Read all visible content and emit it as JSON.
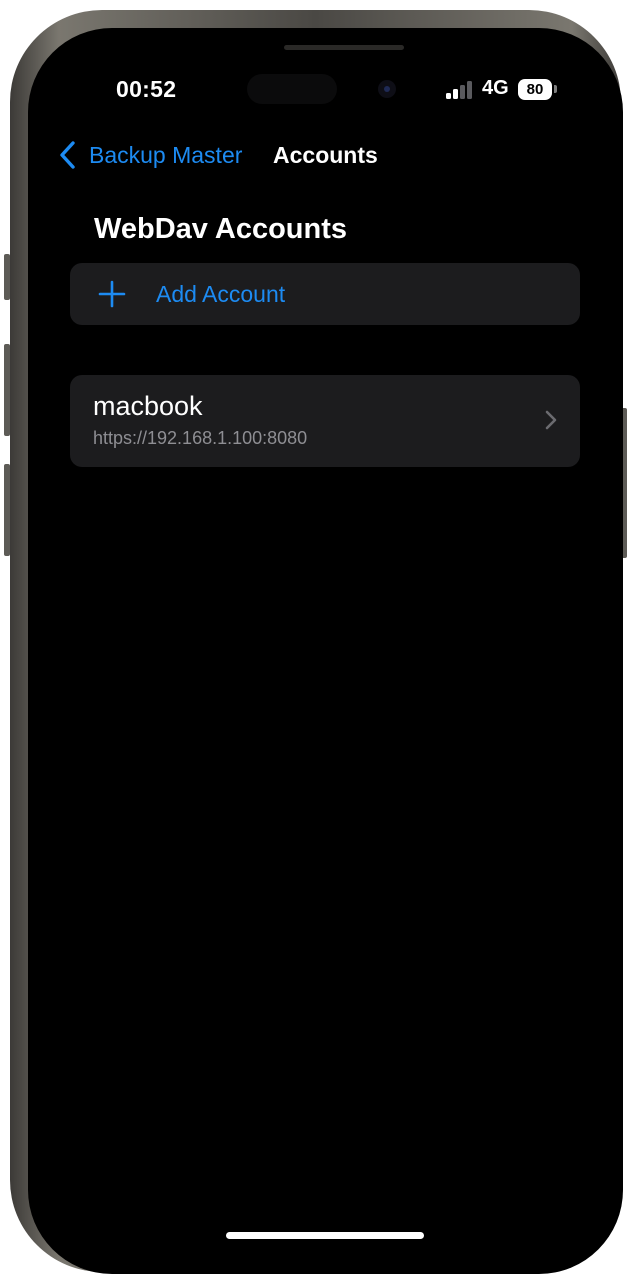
{
  "status_bar": {
    "time": "00:52",
    "network": "4G",
    "battery": "80",
    "signal_bars_active": 2,
    "signal_bars_total": 4
  },
  "nav": {
    "back_label": "Backup Master",
    "title": "Accounts"
  },
  "section": {
    "title": "WebDav Accounts"
  },
  "add_account": {
    "label": "Add Account"
  },
  "accounts": [
    {
      "name": "macbook",
      "url": "https://192.168.1.100:8080"
    }
  ],
  "colors": {
    "accent": "#1d8bf2",
    "background": "#000000",
    "cell": "#1c1c1e",
    "secondary_text": "#8e8e93"
  },
  "icons": {
    "back": "chevron-left-icon",
    "add": "plus-icon",
    "disclosure": "chevron-right-icon"
  }
}
